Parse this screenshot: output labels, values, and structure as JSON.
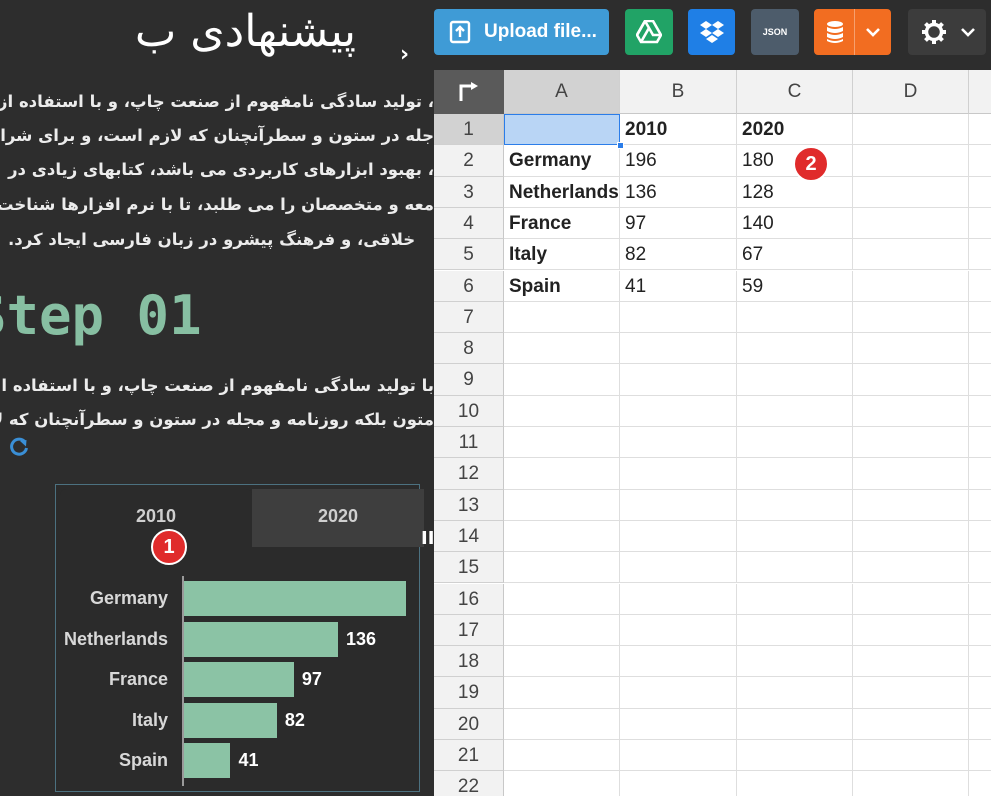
{
  "article": {
    "title": "پیشنهادی ب",
    "title_chevron": "›",
    "paragraph1": [
      "، تولید سادگی نامفهوم از صنعت چاپ، و با استفاده از",
      "جله در ستون و سطرآنچنان که لازم است، و برای شرا",
      "، بهبود ابزارهای کاربردی می باشد، کتابهای زیادی در",
      "معه و متخصصان را می طلبد، تا با نرم افزارها شناخت",
      "خلاقی، و فرهنگ پیشرو در زبان فارسی ایجاد کرد."
    ],
    "step_heading": "Step 01",
    "paragraph2": [
      "با تولید سادگی نامفهوم از صنعت چاپ، و با استفاده ا",
      "متون بلکه روزنامه و مجله در ستون و سطرآنچنان که لا"
    ],
    "refresh_icon": "refresh-icon"
  },
  "chart_widget": {
    "tabs": [
      {
        "label": "2010",
        "active": true
      },
      {
        "label": "2020",
        "active": false
      }
    ],
    "resize_grip": "II"
  },
  "chart_data": {
    "type": "bar",
    "orientation": "horizontal",
    "categories": [
      "Germany",
      "Netherlands",
      "France",
      "Italy",
      "Spain"
    ],
    "values": [
      196,
      136,
      97,
      82,
      41
    ],
    "values_text": [
      "",
      "136",
      "97",
      "82",
      "41"
    ],
    "grid": false,
    "bar_color": "#8bc3a5"
  },
  "badges": {
    "one": "1",
    "two": "2"
  },
  "toolbar": {
    "upload_label": "Upload file...",
    "json_label": "JSON",
    "colors": {
      "upload": "#3f9bd6",
      "google_drive": "#21a366",
      "dropbox": "#1f7fe6",
      "json": "#4d5c6b",
      "database": "#f26d21",
      "settings": "#3c3c3c"
    }
  },
  "spreadsheet": {
    "columns": [
      "A",
      "B",
      "C",
      "D"
    ],
    "row_numbers": [
      "1",
      "2",
      "3",
      "4",
      "5",
      "6",
      "7",
      "8",
      "9",
      "10",
      "11",
      "12",
      "13",
      "14",
      "15",
      "16",
      "17",
      "18",
      "19",
      "20",
      "21",
      "22"
    ],
    "rows": [
      [
        "",
        "2010",
        "2020",
        ""
      ],
      [
        "Germany",
        "196",
        "180",
        ""
      ],
      [
        "Netherlands",
        "136",
        "128",
        ""
      ],
      [
        "France",
        "97",
        "140",
        ""
      ],
      [
        "Italy",
        "82",
        "67",
        ""
      ],
      [
        "Spain",
        "41",
        "59",
        ""
      ]
    ],
    "selected_cell": "A1",
    "selection_color": "#b9d5f5"
  }
}
